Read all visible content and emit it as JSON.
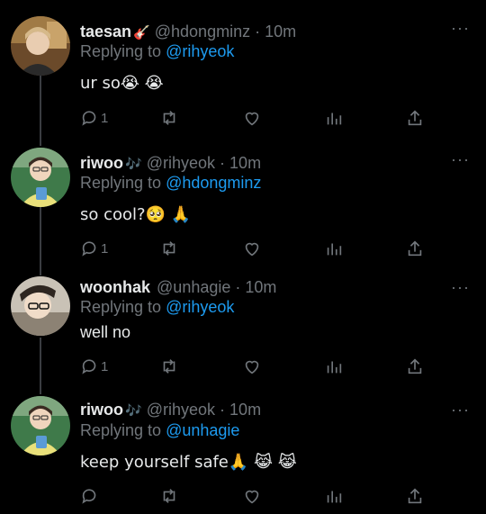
{
  "colors": {
    "background": "#000000",
    "text": "#e7e9ea",
    "muted": "#71767b",
    "mention": "#1d9bf0"
  },
  "tweets": [
    {
      "name": "taesan",
      "badge": "🎸",
      "handle": "@hdongminz",
      "dot": "·",
      "time": "10m",
      "reply_prefix": "Replying to",
      "reply_to": "@rihyeok",
      "text": "ur so😭 😭",
      "reply_count": "1",
      "more": "···"
    },
    {
      "name": "riwoo",
      "badge": "🎶",
      "handle": "@rihyeok",
      "dot": "·",
      "time": "10m",
      "reply_prefix": "Replying to",
      "reply_to": "@hdongminz",
      "text": "so cool?🥺 🙏",
      "reply_count": "1",
      "more": "···"
    },
    {
      "name": "woonhak",
      "badge": "",
      "handle": "@unhagie",
      "dot": "·",
      "time": "10m",
      "reply_prefix": "Replying to",
      "reply_to": "@rihyeok",
      "text": "well no",
      "reply_count": "1",
      "more": "···"
    },
    {
      "name": "riwoo",
      "badge": "🎶",
      "handle": "@rihyeok",
      "dot": "·",
      "time": "10m",
      "reply_prefix": "Replying to",
      "reply_to": "@unhagie",
      "text": "keep yourself safe🙏 😹 😹",
      "reply_count": "",
      "more": "···"
    }
  ],
  "icons": {
    "reply": "reply-icon",
    "retweet": "retweet-icon",
    "like": "heart-icon",
    "views": "views-icon",
    "share": "share-icon",
    "more": "more-icon"
  }
}
